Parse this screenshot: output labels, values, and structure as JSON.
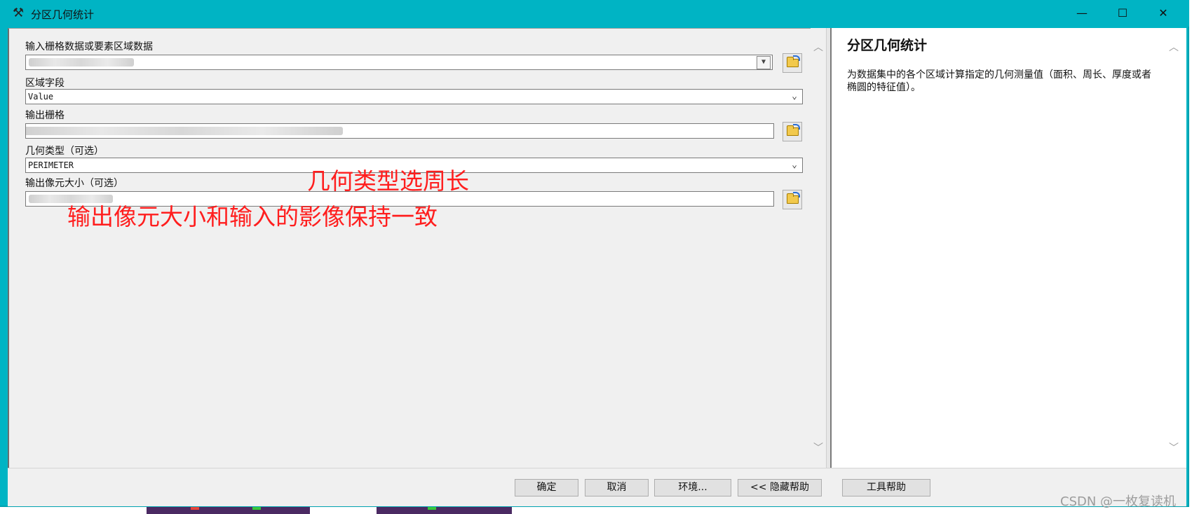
{
  "window": {
    "title": "分区几何统计",
    "icon": "hammer-icon",
    "minimize_glyph": "—",
    "maximize_glyph": "☐",
    "close_glyph": "✕"
  },
  "params": [
    {
      "label": "输入栅格数据或要素区域数据",
      "value": ""
    },
    {
      "label": "区域字段",
      "value": "Value"
    },
    {
      "label": "输出栅格",
      "value": ""
    },
    {
      "label": "几何类型（可选）",
      "value": "PERIMETER"
    },
    {
      "label": "输出像元大小（可选）",
      "value": ""
    }
  ],
  "annotations": {
    "geometry_type_note": "几何类型选周长",
    "cell_size_note": "输出像元大小和输入的影像保持一致"
  },
  "help": {
    "title": "分区几何统计",
    "body": "为数据集中的各个区域计算指定的几何测量值（面积、周长、厚度或者椭圆的特征值）。"
  },
  "buttons": {
    "ok": "确定",
    "cancel": "取消",
    "environments": "环境...",
    "hide_help": "<< 隐藏帮助",
    "tool_help": "工具帮助"
  },
  "scroll": {
    "up_glyph": "︿",
    "down_glyph": "﹀"
  },
  "combo_glyph": "⌄",
  "combo_boxed_glyph": "▼",
  "watermark": "CSDN @一枚复读机",
  "colors": {
    "titlebar": "#00b4c4",
    "annotation": "#ff1e1e",
    "panel": "#f0f0f0"
  }
}
